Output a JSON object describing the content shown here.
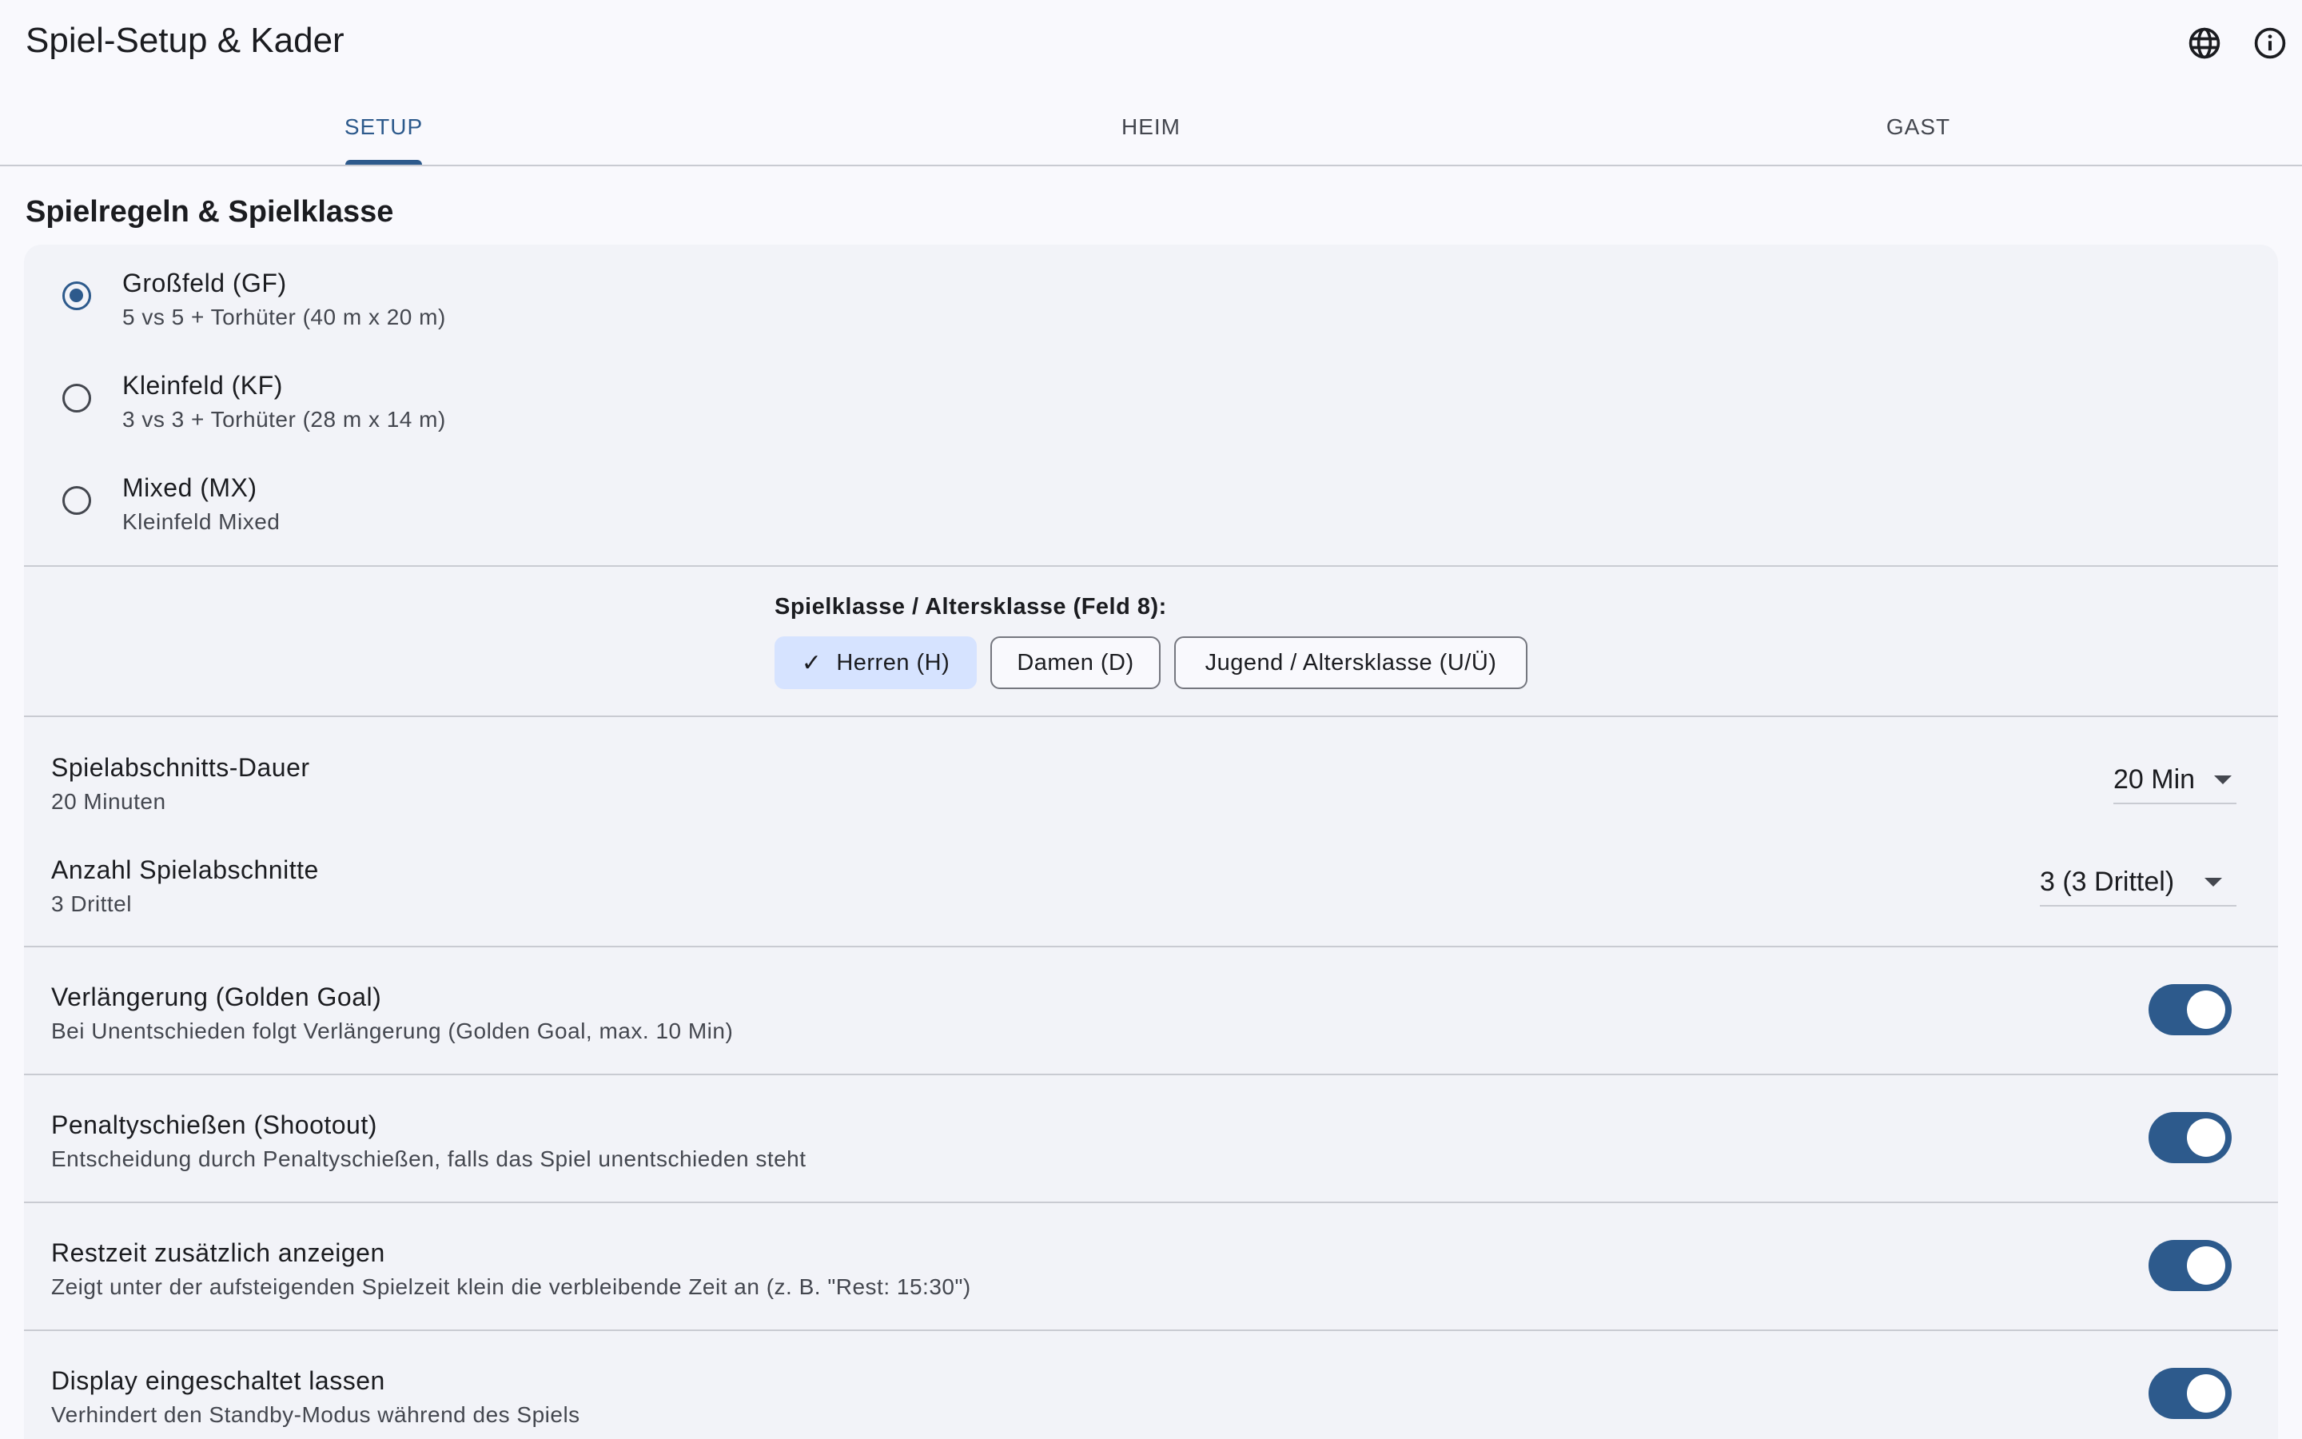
{
  "header": {
    "title": "Spiel-Setup & Kader",
    "icons": [
      "globe-icon",
      "info-icon"
    ]
  },
  "tabs": [
    {
      "label": "SETUP",
      "active": true
    },
    {
      "label": "HEIM",
      "active": false
    },
    {
      "label": "GAST",
      "active": false
    }
  ],
  "section": {
    "heading": "Spielregeln & Spielklasse"
  },
  "game_modes": [
    {
      "title": "Großfeld (GF)",
      "subtitle": "5 vs 5 + Torhüter (40 m x 20 m)",
      "selected": true
    },
    {
      "title": "Kleinfeld (KF)",
      "subtitle": "3 vs 3 + Torhüter (28 m x 14 m)",
      "selected": false
    },
    {
      "title": "Mixed (MX)",
      "subtitle": "Kleinfeld Mixed",
      "selected": false
    }
  ],
  "klasse": {
    "label": "Spielklasse / Altersklasse (Feld 8):",
    "chips": [
      {
        "label": "Herren (H)",
        "selected": true
      },
      {
        "label": "Damen (D)",
        "selected": false
      },
      {
        "label": "Jugend / Altersklasse (U/Ü)",
        "selected": false
      }
    ]
  },
  "settings": [
    {
      "title": "Spielabschnitts-Dauer",
      "subtitle": "20 Minuten",
      "value": "20 Min"
    },
    {
      "title": "Anzahl Spielabschnitte",
      "subtitle": "3 Drittel",
      "value": "3 (3 Drittel)"
    }
  ],
  "toggles": [
    {
      "title": "Verlängerung (Golden Goal)",
      "subtitle": "Bei Unentschieden folgt Verlängerung (Golden Goal, max. 10 Min)",
      "on": true
    },
    {
      "title": "Penaltyschießen (Shootout)",
      "subtitle": "Entscheidung durch Penaltyschießen, falls das Spiel unentschieden steht",
      "on": true
    },
    {
      "title": "Restzeit zusätzlich anzeigen",
      "subtitle": "Zeigt unter der aufsteigenden Spielzeit klein die verbleibende Zeit an (z. B. \"Rest: 15:30\")",
      "on": true
    },
    {
      "title": "Display eingeschaltet lassen",
      "subtitle": "Verhindert den Standby-Modus während des Spiels",
      "on": true
    }
  ],
  "colors": {
    "accent": "#2d5a8c",
    "chip_selected": "#d6e3ff",
    "background": "#f9f9fd",
    "card": "#f2f3f8"
  }
}
